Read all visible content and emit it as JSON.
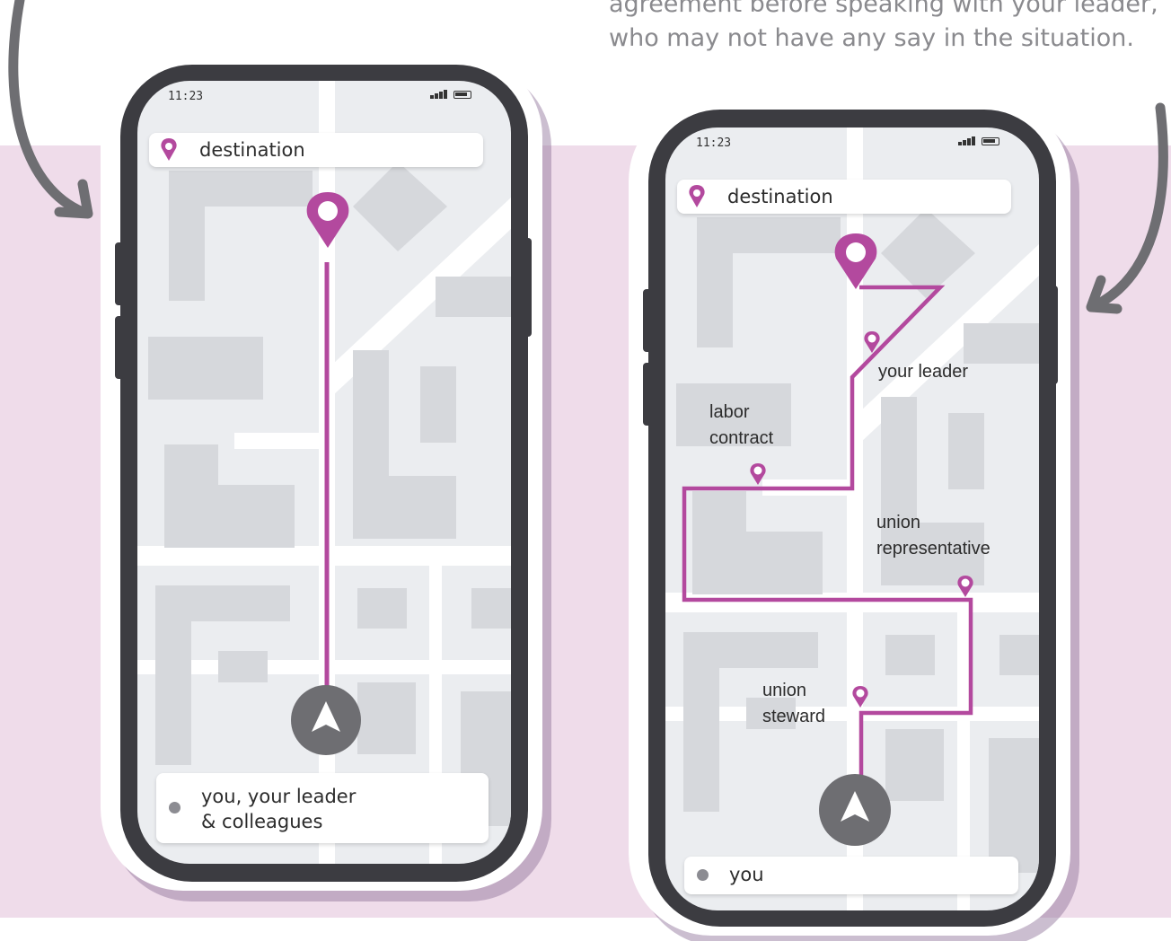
{
  "caption": {
    "line1": "agreement before speaking with your leader,",
    "line2": "who may not have any say in the situation."
  },
  "colors": {
    "route": "#b3499e",
    "band": "#efdcea",
    "frame": "#3c3c41"
  },
  "phone_left": {
    "time": "11:23",
    "destination": "destination",
    "bottom_line1": "you, your leader",
    "bottom_line2": "& colleagues",
    "icons": [
      "pin-icon",
      "map-pin-icon",
      "navigation-arrow-icon",
      "signal-icon",
      "battery-icon"
    ]
  },
  "phone_right": {
    "time": "11:23",
    "destination": "destination",
    "bottom": "you",
    "stops": {
      "your_leader": "your leader",
      "labor_1": "labor",
      "labor_2": "contract",
      "rep_1": "union",
      "rep_2": "representative",
      "steward_1": "union",
      "steward_2": "steward"
    }
  }
}
